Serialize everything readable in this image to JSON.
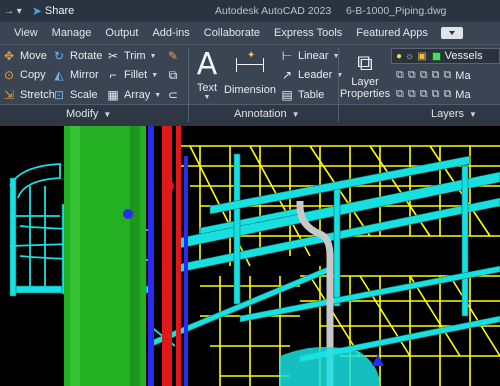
{
  "titlebar": {
    "share_label": "Share",
    "app_title": "Autodesk AutoCAD 2023",
    "file_name": "6-B-1000_Piping.dwg"
  },
  "tabs": [
    "View",
    "Manage",
    "Output",
    "Add-ins",
    "Collaborate",
    "Express Tools",
    "Featured Apps"
  ],
  "modify": {
    "title": "Modify",
    "move": "Move",
    "rotate": "Rotate",
    "trim": "Trim",
    "copy": "Copy",
    "mirror": "Mirror",
    "fillet": "Fillet",
    "stretch": "Stretch",
    "scale": "Scale",
    "array": "Array"
  },
  "annotation": {
    "title": "Annotation",
    "text": "Text",
    "dimension": "Dimension",
    "linear": "Linear",
    "leader": "Leader",
    "table": "Table"
  },
  "layers": {
    "title": "Layers",
    "properties_line1": "Layer",
    "properties_line2": "Properties",
    "current_layer": "Vessels",
    "row_label": "Ma",
    "colors": {
      "current_swatch": "#56d36b"
    }
  },
  "drawing": {
    "colors": {
      "background": "#000000",
      "steel": "#19e0e0",
      "handrail": "#ffff00",
      "vessel": "#23b023",
      "pipe_red": "#e01818",
      "pipe_blue": "#2a2af0",
      "pipe_white": "#c8c8c8"
    }
  }
}
